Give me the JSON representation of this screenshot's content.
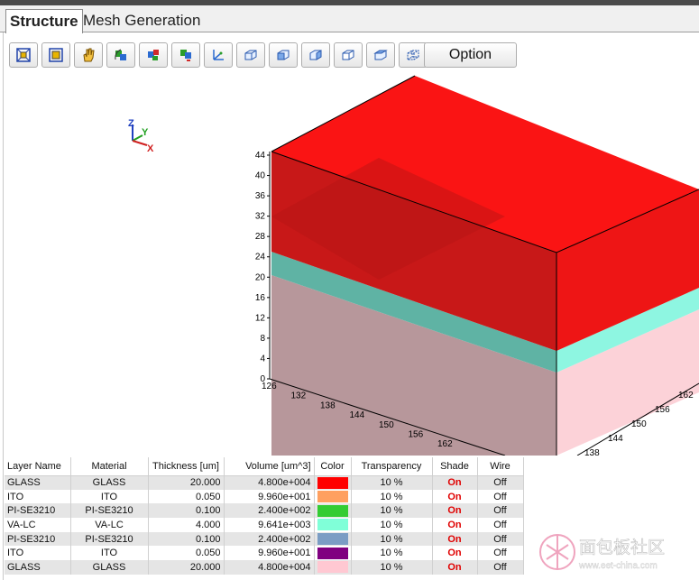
{
  "tabs": [
    {
      "label": "Structure",
      "active": true
    },
    {
      "label": "Mesh Generation",
      "active": false
    }
  ],
  "toolbar": {
    "buttons": [
      {
        "name": "fit-view-icon"
      },
      {
        "name": "zoom-box-icon"
      },
      {
        "name": "pan-hand-icon"
      },
      {
        "name": "rotate-xy-icon"
      },
      {
        "name": "rotate-xz-icon"
      },
      {
        "name": "rotate-yz-icon"
      },
      {
        "name": "axis-view-icon"
      },
      {
        "name": "cube-iso-icon"
      },
      {
        "name": "cube-front-icon"
      },
      {
        "name": "cube-side-icon"
      },
      {
        "name": "cube-top-icon"
      },
      {
        "name": "cube-back-icon"
      },
      {
        "name": "cube-wire-icon"
      }
    ],
    "option_label": "Option"
  },
  "viewport": {
    "triad": {
      "x": "X",
      "y": "Y",
      "z": "Z"
    },
    "z_ticks": [
      "44",
      "40",
      "36",
      "32",
      "28",
      "24",
      "20",
      "16",
      "12",
      "8",
      "4",
      "0"
    ],
    "x_ticks": [
      "126",
      "132",
      "138",
      "144",
      "150",
      "156",
      "162"
    ],
    "y_ticks": [
      "162",
      "156",
      "150",
      "144",
      "138"
    ]
  },
  "table": {
    "headers": [
      "Layer Name",
      "Material",
      "Thickness [um]",
      "Volume [um^3]",
      "Color",
      "Transparency",
      "Shade",
      "Wire"
    ],
    "rows": [
      {
        "name": "GLASS",
        "material": "GLASS",
        "thickness": "20.000",
        "volume": "4.800e+004",
        "color": "#ff0000",
        "transparency": "10 %",
        "shade": "On",
        "wire": "Off"
      },
      {
        "name": "ITO",
        "material": "ITO",
        "thickness": "0.050",
        "volume": "9.960e+001",
        "color": "#ffa060",
        "transparency": "10 %",
        "shade": "On",
        "wire": "Off"
      },
      {
        "name": "PI-SE3210",
        "material": "PI-SE3210",
        "thickness": "0.100",
        "volume": "2.400e+002",
        "color": "#33cc33",
        "transparency": "10 %",
        "shade": "On",
        "wire": "Off"
      },
      {
        "name": "VA-LC",
        "material": "VA-LC",
        "thickness": "4.000",
        "volume": "9.641e+003",
        "color": "#80ffd8",
        "transparency": "10 %",
        "shade": "On",
        "wire": "Off"
      },
      {
        "name": "PI-SE3210",
        "material": "PI-SE3210",
        "thickness": "0.100",
        "volume": "2.400e+002",
        "color": "#7b9dc4",
        "transparency": "10 %",
        "shade": "On",
        "wire": "Off"
      },
      {
        "name": "ITO",
        "material": "ITO",
        "thickness": "0.050",
        "volume": "9.960e+001",
        "color": "#800080",
        "transparency": "10 %",
        "shade": "On",
        "wire": "Off"
      },
      {
        "name": "GLASS",
        "material": "GLASS",
        "thickness": "20.000",
        "volume": "4.800e+004",
        "color": "#ffc8d2",
        "transparency": "10 %",
        "shade": "On",
        "wire": "Off"
      }
    ]
  },
  "watermark": {
    "title": "面包板社区",
    "url": "www.eet-china.com"
  }
}
